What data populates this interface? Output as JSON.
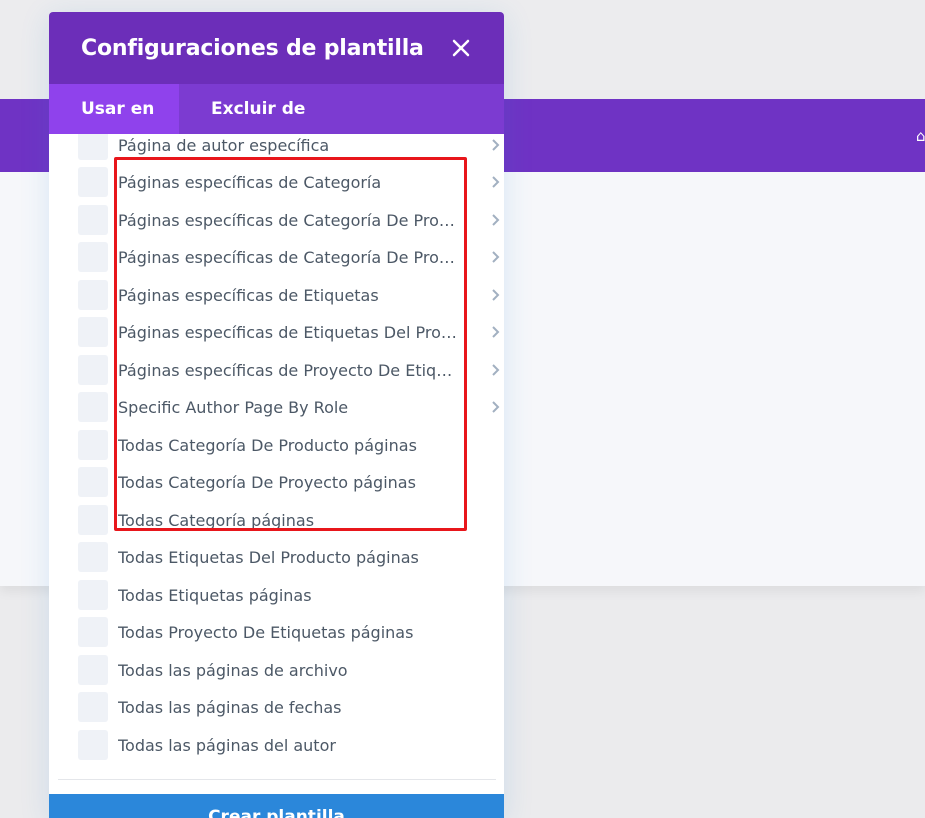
{
  "modal": {
    "title": "Configuraciones de plantilla",
    "tabs": [
      {
        "label": "Usar en",
        "active": true
      },
      {
        "label": "Excluir de",
        "active": false
      }
    ],
    "options": [
      {
        "label": "Página de autor específica",
        "has_submenu": true
      },
      {
        "label": "Páginas específicas de Categoría",
        "has_submenu": true
      },
      {
        "label": "Páginas específicas de Categoría De Producto",
        "has_submenu": true
      },
      {
        "label": "Páginas específicas de Categoría De Proyecto",
        "has_submenu": true
      },
      {
        "label": "Páginas específicas de Etiquetas",
        "has_submenu": true
      },
      {
        "label": "Páginas específicas de Etiquetas Del Producto",
        "has_submenu": true
      },
      {
        "label": "Páginas específicas de Proyecto De Etiquetas",
        "has_submenu": true
      },
      {
        "label": "Specific Author Page By Role",
        "has_submenu": true
      },
      {
        "label": "Todas Categoría De Producto páginas",
        "has_submenu": false
      },
      {
        "label": "Todas Categoría De Proyecto páginas",
        "has_submenu": false
      },
      {
        "label": "Todas Categoría páginas",
        "has_submenu": false
      },
      {
        "label": "Todas Etiquetas Del Producto páginas",
        "has_submenu": false
      },
      {
        "label": "Todas Etiquetas páginas",
        "has_submenu": false
      },
      {
        "label": "Todas Proyecto De Etiquetas páginas",
        "has_submenu": false
      },
      {
        "label": "Todas las páginas de archivo",
        "has_submenu": false
      },
      {
        "label": "Todas las páginas de fechas",
        "has_submenu": false
      },
      {
        "label": "Todas las páginas del autor",
        "has_submenu": false
      }
    ],
    "create_button": "Crear plantilla"
  },
  "colors": {
    "header": "#6c2eb9",
    "tabs_bg": "#7c3bd1",
    "tab_active": "#8f42ec",
    "button": "#2b87da",
    "highlight": "#e8161b"
  },
  "icons": {
    "close": "close-icon",
    "chevron": "chevron-right-icon"
  }
}
